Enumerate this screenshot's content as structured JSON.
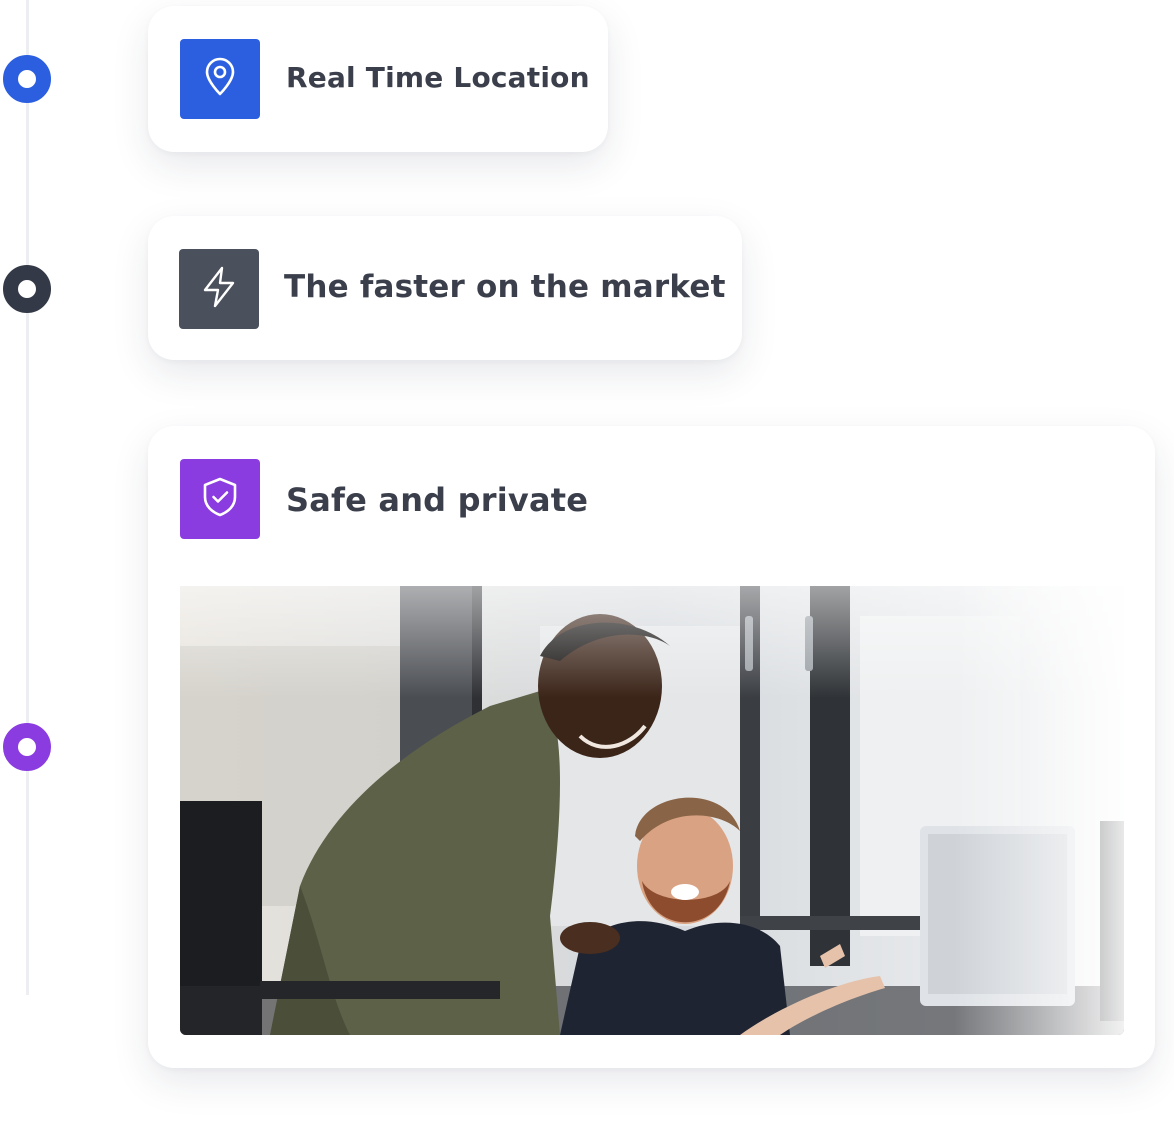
{
  "timeline": {
    "colors": [
      "#2b5fe0",
      "#333946",
      "#8a3ce0"
    ]
  },
  "features": [
    {
      "label": "Real Time Location",
      "icon": "location-pin-icon",
      "icon_bg": "#2b5fe0"
    },
    {
      "label": "The faster on the market",
      "icon": "lightning-bolt-icon",
      "icon_bg": "#4a505c"
    },
    {
      "label": "Safe and private",
      "icon": "shield-check-icon",
      "icon_bg": "#8a3ce0"
    }
  ],
  "photo": {
    "subject": "two-men-at-office-desk-photo"
  }
}
